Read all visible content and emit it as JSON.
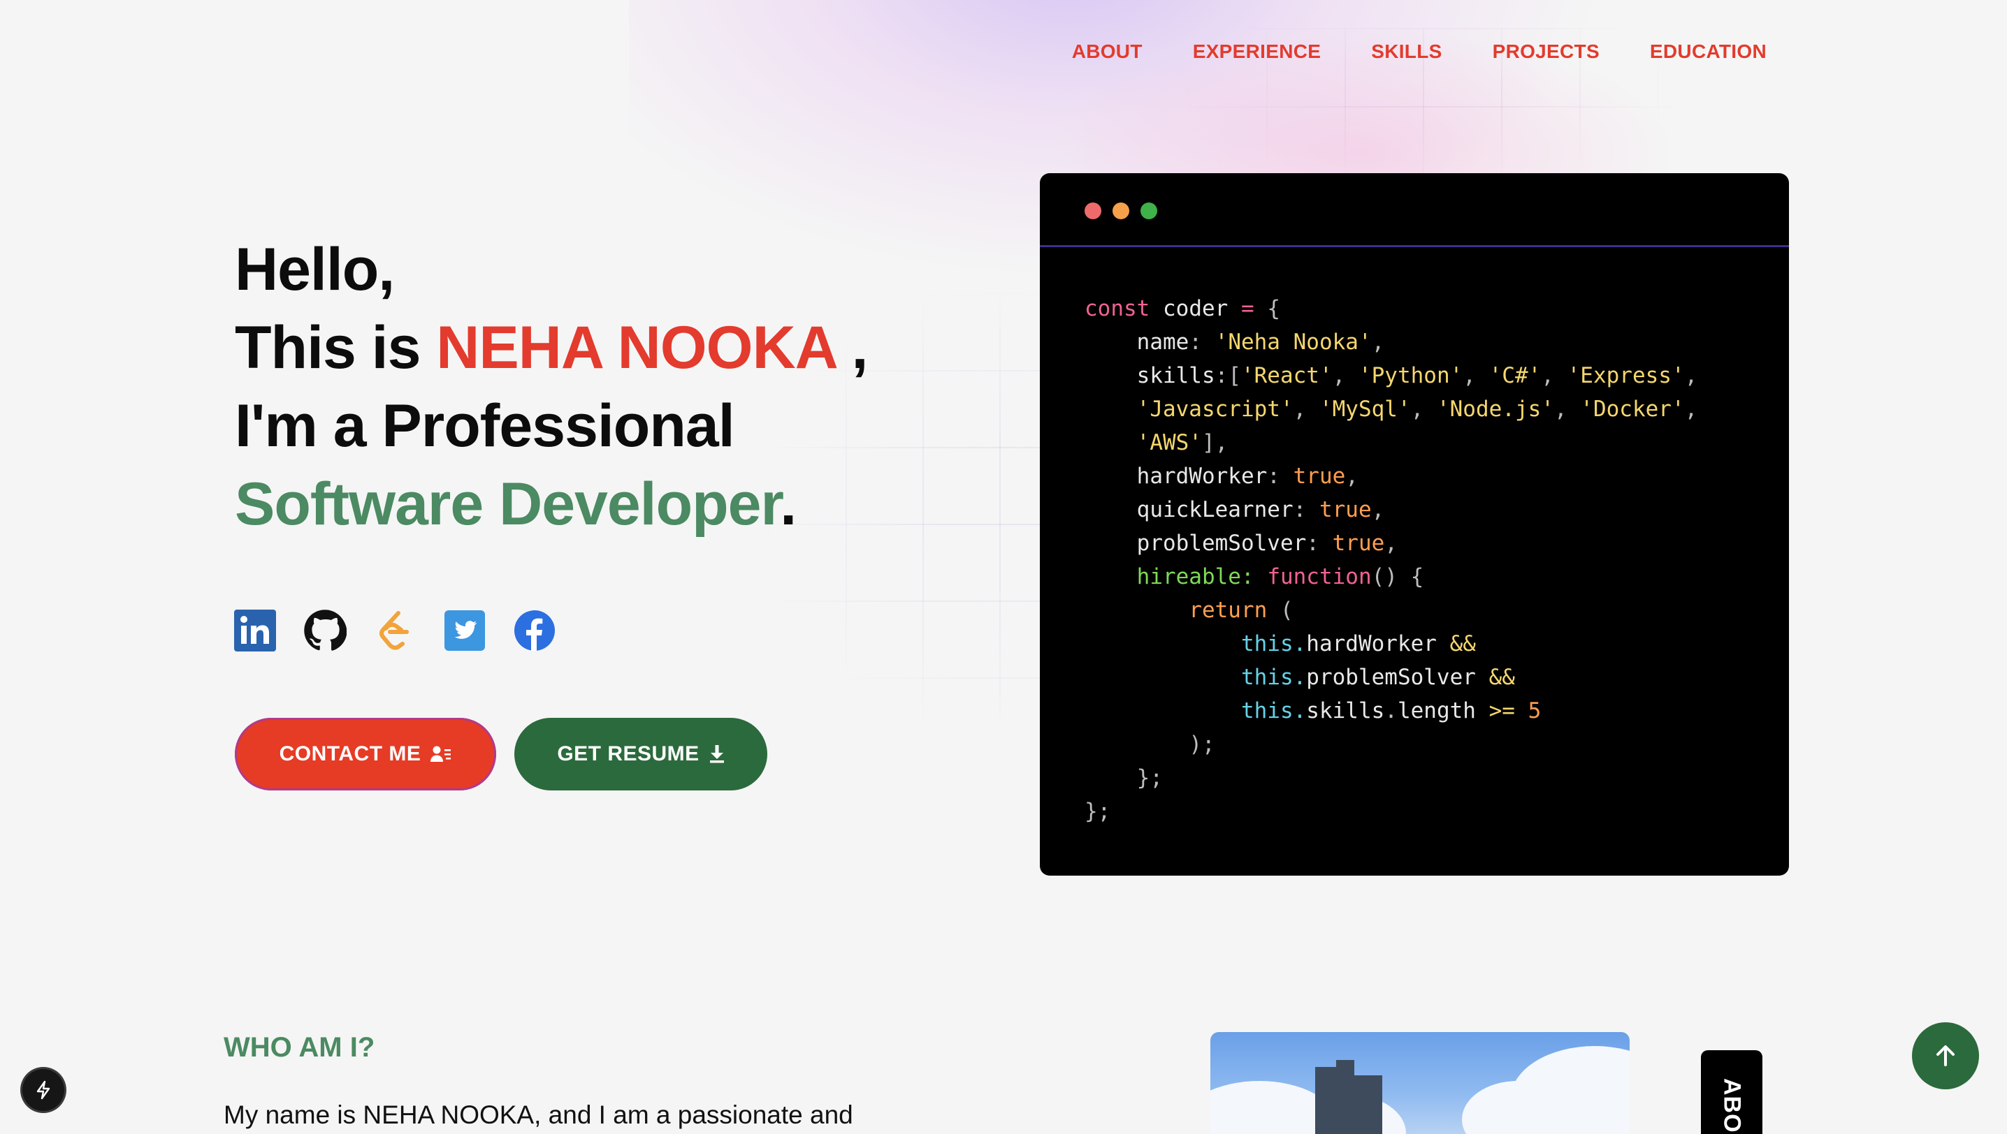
{
  "nav": {
    "items": [
      "ABOUT",
      "EXPERIENCE",
      "SKILLS",
      "PROJECTS",
      "EDUCATION"
    ]
  },
  "hero": {
    "line1": "Hello,",
    "line2_prefix": "This is ",
    "name": "NEHA NOOKA",
    "line2_suffix": " ,",
    "line3": "I'm a Professional",
    "role": "Software Developer",
    "role_suffix": "."
  },
  "socials": [
    "linkedin-icon",
    "github-icon",
    "leetcode-icon",
    "twitter-icon",
    "facebook-icon"
  ],
  "buttons": {
    "contact": "CONTACT ME",
    "resume": "GET RESUME"
  },
  "code": {
    "window_dots": [
      "#ef6b6b",
      "#f5a04a",
      "#3fb24a"
    ],
    "lines": [
      "const coder = {",
      "    name: 'Neha Nooka',",
      "    skills:['React', 'Python', 'C#', 'Express',",
      "    'Javascript', 'MySql', 'Node.js', 'Docker',",
      "    'AWS'],",
      "    hardWorker: true,",
      "    quickLearner: true,",
      "    problemSolver: true,",
      "    hireable: function() {",
      "        return (",
      "            this.hardWorker &&",
      "            this.problemSolver &&",
      "            this.skills.length >= 5",
      "        );",
      "    };",
      "};"
    ]
  },
  "about": {
    "heading": "WHO AM I?",
    "intro": "My name is NEHA NOOKA, and I am a passionate and",
    "side_tab": "ABOUT"
  },
  "colors": {
    "accent_red": "#e33b2d",
    "accent_green": "#4b8a62",
    "button_green": "#2b6a3c"
  }
}
